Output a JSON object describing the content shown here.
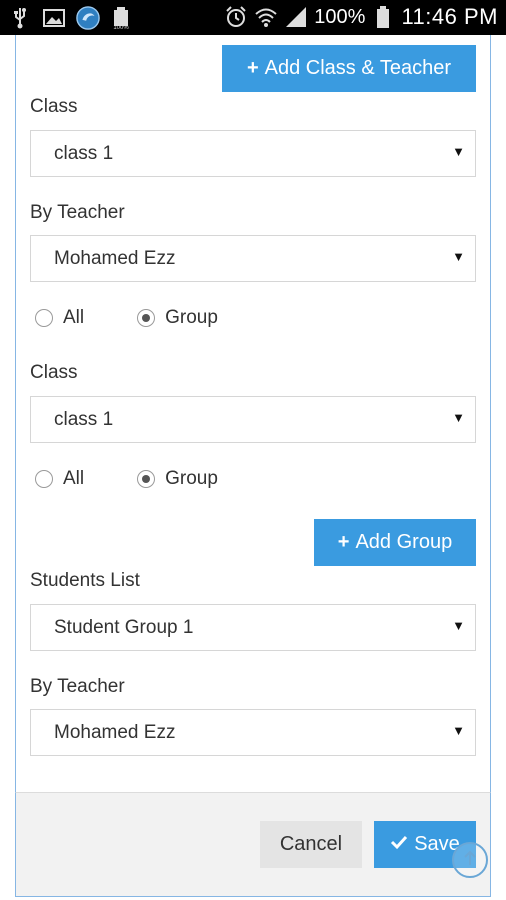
{
  "statusbar": {
    "battery_percent": "100%",
    "time": "11:46 PM",
    "left_icons": [
      "usb-icon",
      "image-icon",
      "app-logo-icon",
      "battery-small-icon"
    ],
    "right_icons": [
      "alarm-icon",
      "wifi-icon",
      "signal-icon",
      "battery-icon"
    ]
  },
  "top_button": {
    "label": "Add Class & Teacher",
    "icon": "plus-icon"
  },
  "section1": {
    "class_label": "Class",
    "class_value": "class 1",
    "teacher_label": "By Teacher",
    "teacher_value": "Mohamed Ezz",
    "radio_all": "All",
    "radio_group": "Group",
    "selected": "Group"
  },
  "section2": {
    "class_label": "Class",
    "class_value": "class 1",
    "radio_all": "All",
    "radio_group": "Group",
    "selected": "Group"
  },
  "add_group_button": {
    "label": "Add Group",
    "icon": "plus-icon"
  },
  "section3": {
    "students_label": "Students List",
    "students_value": "Student Group 1",
    "teacher_label": "By Teacher",
    "teacher_value": "Mohamed Ezz"
  },
  "footer": {
    "cancel_label": "Cancel",
    "save_label": "Save",
    "save_icon": "check-icon"
  },
  "colors": {
    "primary": "#3a9be0",
    "panel_border": "#86b6e4",
    "footer_bg": "#f2f2f2"
  }
}
